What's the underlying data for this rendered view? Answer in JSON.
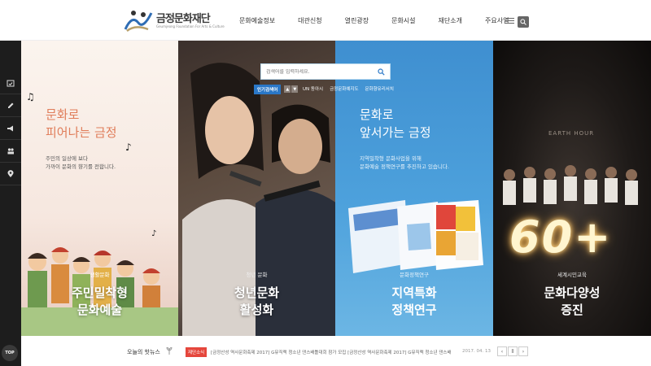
{
  "header": {
    "logo_text": "금정문화재단",
    "logo_sub": "Geumjeong Foundation For Arts & Culture",
    "nav": [
      "문화예술정보",
      "대관신청",
      "열린광장",
      "문화시설",
      "재단소개",
      "주요사업"
    ]
  },
  "rail": {
    "icons": [
      "calendar-check-icon",
      "pencil-icon",
      "megaphone-icon",
      "people-icon",
      "map-pin-icon"
    ],
    "top_label": "TOP"
  },
  "search": {
    "placeholder": "검색어를 입력하세요.",
    "popular_label": "인기검색어",
    "popular_links": [
      "UN 동아시",
      "금정문화예지도",
      "문화향유리서치"
    ]
  },
  "panels": [
    {
      "heading": "문화로\n피어나는 금정",
      "desc": "주민의 일상에 보다\n가까이 문화의 향기를 전합니다.",
      "category": "생활문화",
      "title": "주민밀착형\n문화예술"
    },
    {
      "category": "청년 문화",
      "title": "청년문화\n활성화"
    },
    {
      "heading": "문화로\n앞서가는 금정",
      "desc": "지역밀착형 문화사업을 위해\n문화예술 정책연구를 추진하고 있습니다.",
      "category": "문화정책연구",
      "title": "지역특화\n정책연구"
    },
    {
      "category": "세계시민교육",
      "title": "문화다양성\n증진",
      "photo_text": "EARTH HOUR",
      "candle_text": "60+"
    }
  ],
  "news": {
    "label": "오늘의 핫뉴스",
    "badge": "재단소식",
    "text": "[금정산성 역사문화축제 2017] G뮤직랙 청소년 댄스배틀대회 참가 모집 [금정산성 역사문화축제 2017] G뮤직랙 청소년 댄스배",
    "date": "2017. 04. 13",
    "prev": "‹",
    "pause": "ll",
    "next": "›"
  },
  "colors": {
    "accent_blue": "#2a77c7",
    "news_badge": "#e5463c",
    "panel1_heading": "#e07d5a",
    "rail_bg": "#1d1d1d"
  }
}
